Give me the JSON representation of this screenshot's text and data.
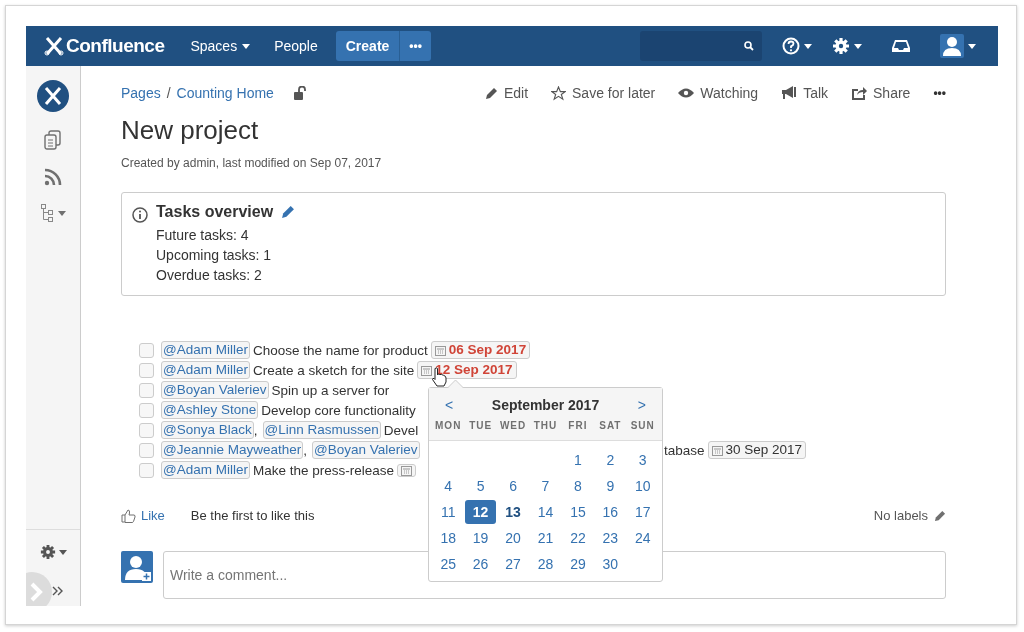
{
  "header": {
    "logo": "Confluence",
    "nav": [
      {
        "label": "Spaces",
        "dropdown": true
      },
      {
        "label": "People",
        "dropdown": false
      }
    ],
    "create": "Create",
    "more": "•••"
  },
  "breadcrumbs": [
    "Pages",
    "Counting Home"
  ],
  "breadcrumb_separator": "/",
  "actions": [
    {
      "kind": "edit",
      "label": "Edit"
    },
    {
      "kind": "star",
      "label": "Save for later"
    },
    {
      "kind": "eye",
      "label": "Watching"
    },
    {
      "kind": "talk",
      "label": "Talk"
    },
    {
      "kind": "share",
      "label": "Share"
    },
    {
      "kind": "more",
      "label": "•••"
    }
  ],
  "title": "New project",
  "meta": "Created by admin, last modified on Sep 07, 2017",
  "panel": {
    "title": "Tasks overview",
    "lines": [
      "Future tasks: 4",
      "Upcoming tasks: 1",
      "Overdue tasks: 2"
    ]
  },
  "tasks": [
    {
      "checked": false,
      "parts": [
        {
          "kind": "mention",
          "text": "@Adam Miller"
        },
        {
          "kind": "text",
          "text": "Choose the name for product"
        },
        {
          "kind": "date",
          "text": "06 Sep 2017",
          "color": "#d04437"
        }
      ]
    },
    {
      "checked": false,
      "parts": [
        {
          "kind": "mention",
          "text": "@Adam Miller"
        },
        {
          "kind": "text",
          "text": "Create a sketch for the site"
        },
        {
          "kind": "date",
          "text": "12 Sep 2017",
          "color": "#d04437"
        }
      ]
    },
    {
      "checked": false,
      "parts": [
        {
          "kind": "mention",
          "text": "@Boyan Valeriev"
        },
        {
          "kind": "text",
          "text": "Spin up a server for"
        }
      ]
    },
    {
      "checked": false,
      "parts": [
        {
          "kind": "mention",
          "text": "@Ashley Stone"
        },
        {
          "kind": "text",
          "text": "Develop core functionality"
        }
      ]
    },
    {
      "checked": false,
      "parts": [
        {
          "kind": "mention",
          "text": "@Sonya Black"
        },
        {
          "kind": "comma",
          "text": ","
        },
        {
          "kind": "mention",
          "text": "@Linn Rasmussen"
        },
        {
          "kind": "text",
          "text": "Devel"
        }
      ]
    },
    {
      "checked": false,
      "parts": [
        {
          "kind": "mention",
          "text": "@Jeannie Mayweather"
        },
        {
          "kind": "comma",
          "text": ","
        },
        {
          "kind": "mention",
          "text": "@Boyan Valeriev"
        }
      ],
      "tail": [
        {
          "kind": "text",
          "text": "tabase"
        },
        {
          "kind": "date",
          "text": "30 Sep 2017",
          "color": "#333333"
        }
      ]
    },
    {
      "checked": false,
      "parts": [
        {
          "kind": "mention",
          "text": "@Adam Miller"
        },
        {
          "kind": "text",
          "text": "Make the press-release"
        },
        {
          "kind": "date"
        }
      ]
    }
  ],
  "calendar": {
    "prev": "<",
    "next": ">",
    "month": "September 2017",
    "weekdays": [
      "MON",
      "TUE",
      "WED",
      "THU",
      "FRI",
      "SAT",
      "SUN"
    ],
    "weeks": [
      {
        "right_aligned": true,
        "days": [
          {
            "label": "1",
            "selected": false,
            "today": false
          },
          {
            "label": "2",
            "selected": false,
            "today": false
          },
          {
            "label": "3",
            "selected": false,
            "today": false
          }
        ]
      },
      {
        "days": [
          {
            "label": "4",
            "selected": false,
            "today": false
          },
          {
            "label": "5",
            "selected": false,
            "today": false
          },
          {
            "label": "6",
            "selected": false,
            "today": false
          },
          {
            "label": "7",
            "selected": false,
            "today": false
          },
          {
            "label": "8",
            "selected": false,
            "today": false
          },
          {
            "label": "9",
            "selected": false,
            "today": false
          },
          {
            "label": "10",
            "selected": false,
            "today": false
          }
        ]
      },
      {
        "days": [
          {
            "label": "11",
            "selected": false,
            "today": false
          },
          {
            "label": "12",
            "selected": true,
            "today": false
          },
          {
            "label": "13",
            "selected": false,
            "today": true
          },
          {
            "label": "14",
            "selected": false,
            "today": false
          },
          {
            "label": "15",
            "selected": false,
            "today": false
          },
          {
            "label": "16",
            "selected": false,
            "today": false
          },
          {
            "label": "17",
            "selected": false,
            "today": false
          }
        ]
      },
      {
        "days": [
          {
            "label": "18",
            "selected": false,
            "today": false
          },
          {
            "label": "19",
            "selected": false,
            "today": false
          },
          {
            "label": "20",
            "selected": false,
            "today": false
          },
          {
            "label": "21",
            "selected": false,
            "today": false
          },
          {
            "label": "22",
            "selected": false,
            "today": false
          },
          {
            "label": "23",
            "selected": false,
            "today": false
          },
          {
            "label": "24",
            "selected": false,
            "today": false
          }
        ]
      },
      {
        "days": [
          {
            "label": "25",
            "selected": false,
            "today": false
          },
          {
            "label": "26",
            "selected": false,
            "today": false
          },
          {
            "label": "27",
            "selected": false,
            "today": false
          },
          {
            "label": "28",
            "selected": false,
            "today": false
          },
          {
            "label": "29",
            "selected": false,
            "today": false
          },
          {
            "label": "30",
            "selected": false,
            "today": false
          }
        ]
      }
    ]
  },
  "like": {
    "label": "Like",
    "note": "Be the first to like this"
  },
  "labels": "No labels",
  "comment": {
    "placeholder": "Write a comment..."
  }
}
